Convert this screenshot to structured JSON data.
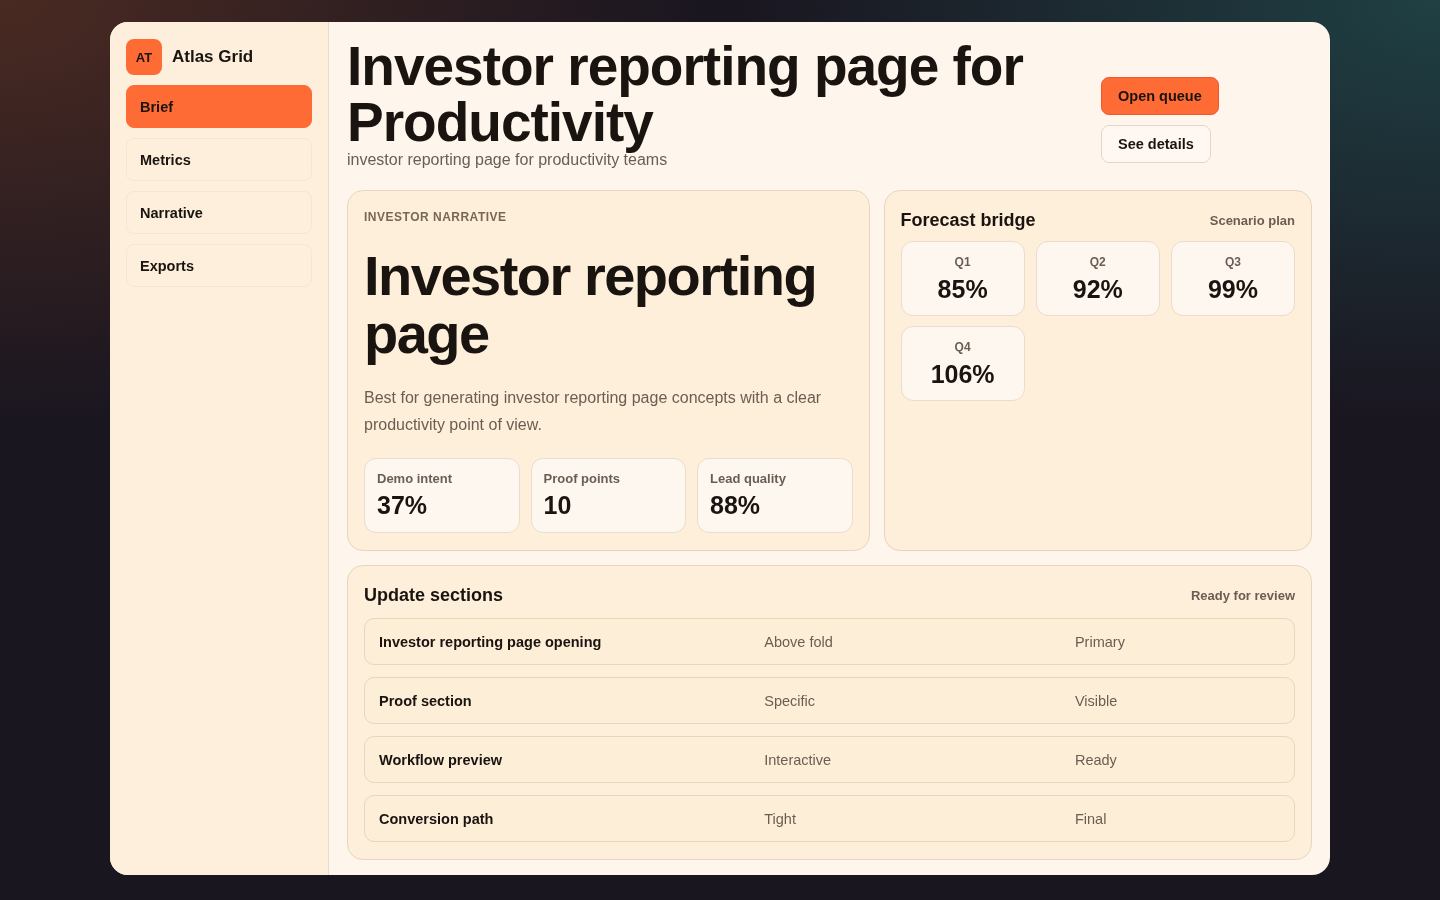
{
  "brand": {
    "initials": "AT",
    "name": "Atlas Grid"
  },
  "nav": [
    {
      "label": "Brief",
      "selected": true
    },
    {
      "label": "Metrics",
      "selected": false
    },
    {
      "label": "Narrative",
      "selected": false
    },
    {
      "label": "Exports",
      "selected": false
    }
  ],
  "header": {
    "title": "Investor reporting page for Productivity",
    "subtitle": "investor reporting page for productivity teams",
    "buttons": [
      {
        "label": "Open queue",
        "kind": "primary"
      },
      {
        "label": "See details",
        "kind": "secondary"
      }
    ]
  },
  "narrative": {
    "eyebrow": "INVESTOR NARRATIVE",
    "heading": "Investor reporting page",
    "body": "Best for generating investor reporting page concepts with a clear productivity point of view.",
    "stats": [
      {
        "label": "Demo intent",
        "value": "37%"
      },
      {
        "label": "Proof points",
        "value": "10"
      },
      {
        "label": "Lead quality",
        "value": "88%"
      }
    ]
  },
  "forecast": {
    "title": "Forecast bridge",
    "note": "Scenario plan",
    "quarters": [
      {
        "label": "Q1",
        "value": "85%"
      },
      {
        "label": "Q2",
        "value": "92%"
      },
      {
        "label": "Q3",
        "value": "99%"
      },
      {
        "label": "Q4",
        "value": "106%"
      }
    ]
  },
  "sections": {
    "title": "Update sections",
    "status": "Ready for review",
    "rows": [
      {
        "cells": [
          "Investor reporting page opening",
          "Above fold",
          "Primary"
        ]
      },
      {
        "cells": [
          "Proof section",
          "Specific",
          "Visible"
        ]
      },
      {
        "cells": [
          "Workflow preview",
          "Interactive",
          "Ready"
        ]
      },
      {
        "cells": [
          "Conversion path",
          "Tight",
          "Final"
        ]
      }
    ]
  }
}
